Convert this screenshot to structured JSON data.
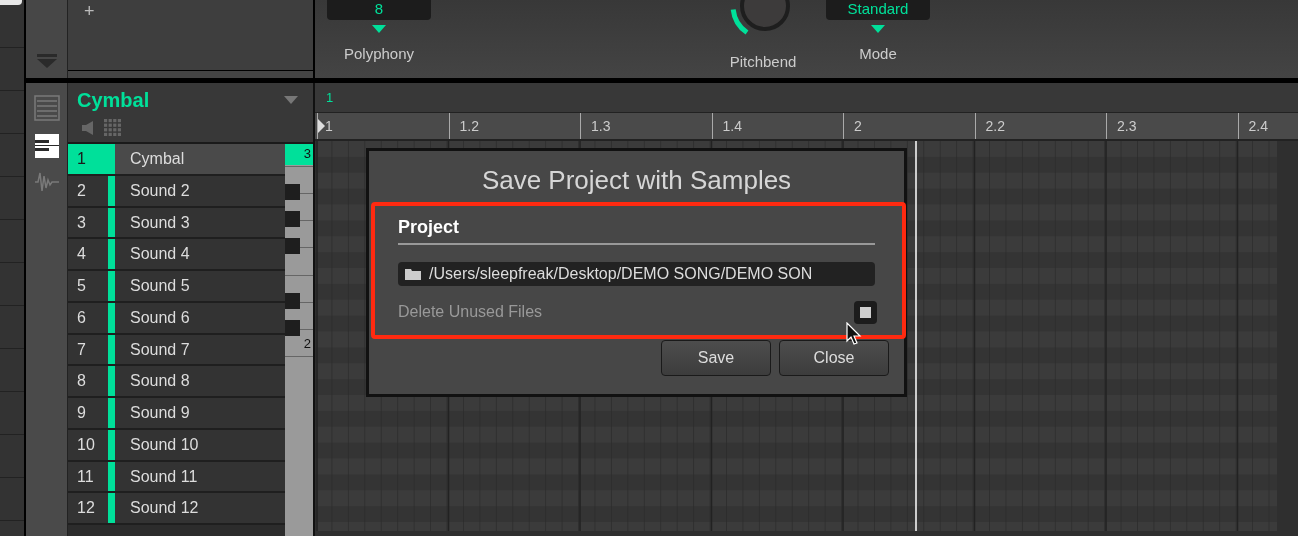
{
  "top_panel": {
    "add_button": "+",
    "polyphony": {
      "value": "8",
      "label": "Polyphony"
    },
    "pitchbend": {
      "label": "Pitchbend"
    },
    "mode": {
      "value": "Standard",
      "label": "Mode"
    }
  },
  "views": [
    {
      "kind": "list",
      "selected": false
    },
    {
      "kind": "keyboard",
      "selected": true
    },
    {
      "kind": "waveform",
      "selected": false
    }
  ],
  "group": {
    "name": "Cymbal"
  },
  "sounds": [
    {
      "number": "1",
      "name": "Cymbal",
      "selected": true,
      "color": "#00e09a"
    },
    {
      "number": "2",
      "name": "Sound 2",
      "selected": false,
      "color": "#00e09a"
    },
    {
      "number": "3",
      "name": "Sound 3",
      "selected": false,
      "color": "#00e09a"
    },
    {
      "number": "4",
      "name": "Sound 4",
      "selected": false,
      "color": "#00e09a"
    },
    {
      "number": "5",
      "name": "Sound 5",
      "selected": false,
      "color": "#00e09a"
    },
    {
      "number": "6",
      "name": "Sound 6",
      "selected": false,
      "color": "#00e09a"
    },
    {
      "number": "7",
      "name": "Sound 7",
      "selected": false,
      "color": "#00e09a"
    },
    {
      "number": "8",
      "name": "Sound 8",
      "selected": false,
      "color": "#00e09a"
    },
    {
      "number": "9",
      "name": "Sound 9",
      "selected": false,
      "color": "#00e09a"
    },
    {
      "number": "10",
      "name": "Sound 10",
      "selected": false,
      "color": "#00e09a"
    },
    {
      "number": "11",
      "name": "Sound 11",
      "selected": false,
      "color": "#00e09a"
    },
    {
      "number": "12",
      "name": "Sound 12",
      "selected": false,
      "color": "#00e09a"
    }
  ],
  "keyboard": {
    "octaves": [
      {
        "label": "3",
        "selected": true
      },
      {
        "label": "2",
        "selected": false
      }
    ]
  },
  "timeline": {
    "bar": "1",
    "ruler": [
      "1",
      "1.2",
      "1.3",
      "1.4",
      "2",
      "2.2",
      "2.3",
      "2.4"
    ]
  },
  "dialog": {
    "title": "Save Project with Samples",
    "section": "Project",
    "path": "/Users/sleepfreak/Desktop/DEMO SONG/DEMO SON",
    "delete_unused": {
      "label": "Delete Unused Files",
      "checked": true
    },
    "buttons": [
      "Save",
      "Close"
    ]
  }
}
